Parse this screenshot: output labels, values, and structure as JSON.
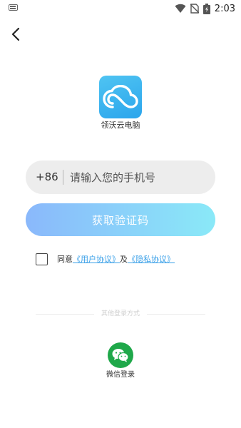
{
  "status_bar": {
    "time": "2:03",
    "icons": [
      "keyboard-icon",
      "wifi-icon",
      "no-sim-icon",
      "battery-charging-icon"
    ]
  },
  "nav": {
    "back_icon": "back-arrow-icon"
  },
  "app": {
    "name": "领沃云电脑",
    "logo_icon": "cloud-logo-icon",
    "brand_color": "#2ba5ec"
  },
  "phone": {
    "country_code": "+86",
    "placeholder": "请输入您的手机号",
    "value": ""
  },
  "get_code_button": {
    "label": "获取验证码",
    "gradient_start": "#8ab8fb",
    "gradient_end": "#8ae9f8"
  },
  "agreement": {
    "checked": false,
    "prefix": "同意",
    "user_agreement": "《用户协议》",
    "conjunction": "及",
    "privacy_agreement": "《隐私协议》",
    "link_color": "#3aa0e8"
  },
  "other_login": {
    "label": "其他登录方式",
    "wechat_label": "微信登录",
    "wechat_icon": "wechat-icon",
    "wechat_color": "#1fa84a"
  }
}
